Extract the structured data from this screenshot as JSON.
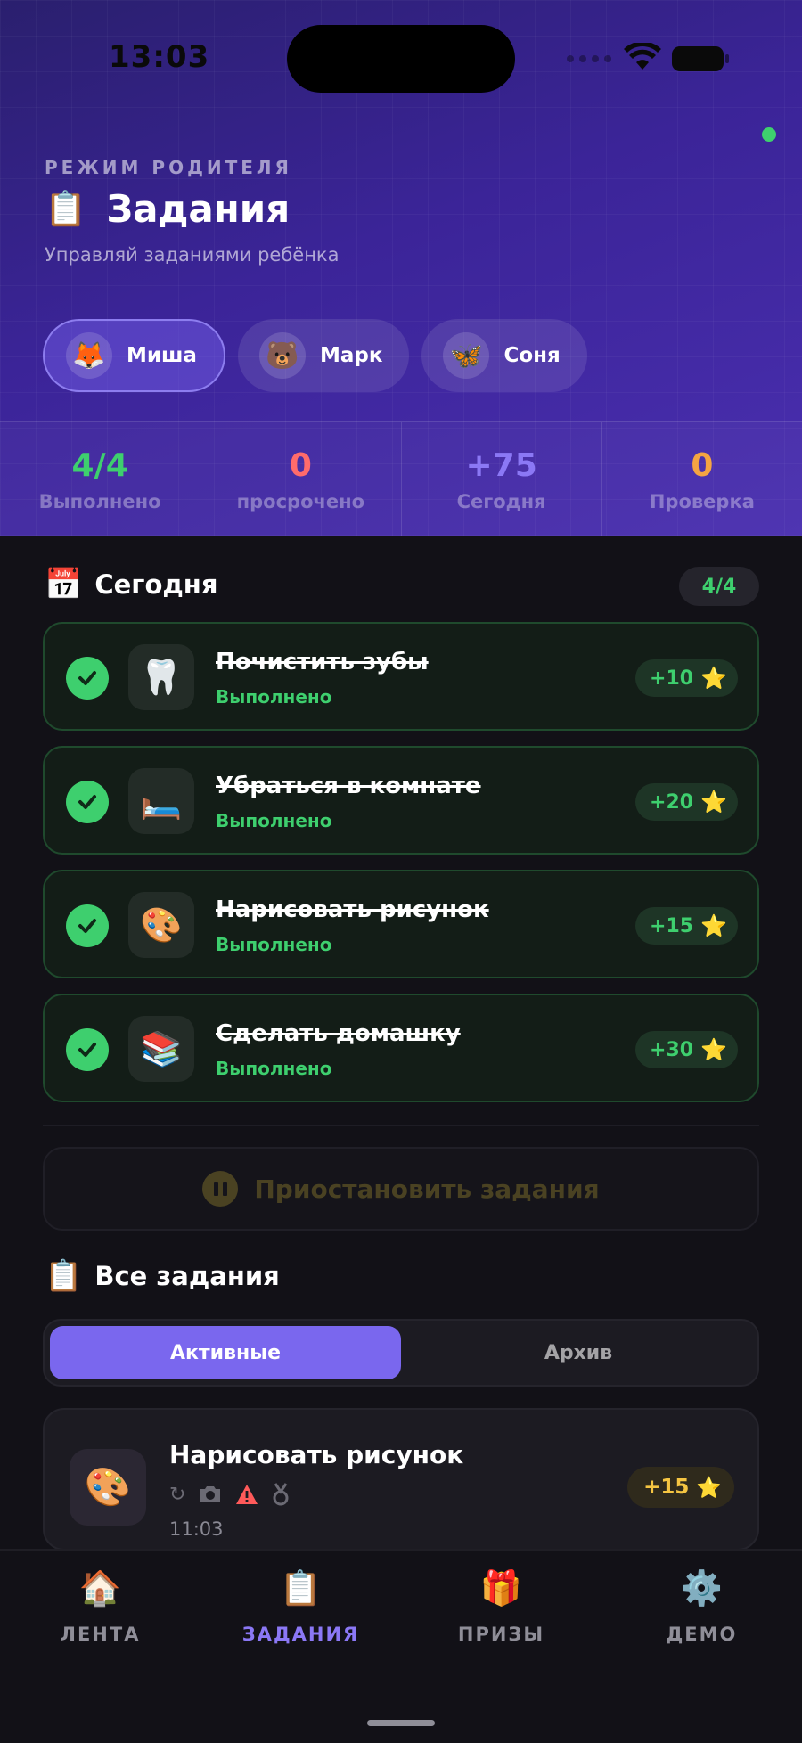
{
  "status_bar": {
    "time": "13:03"
  },
  "header": {
    "mode_label": "РЕЖИМ РОДИТЕЛЯ",
    "title_icon": "📋",
    "title": "Задания",
    "subtitle": "Управляй заданиями ребёнка"
  },
  "kids": [
    {
      "avatar": "🦊",
      "name": "Миша",
      "active": true
    },
    {
      "avatar": "🐻",
      "name": "Марк",
      "active": false
    },
    {
      "avatar": "🦋",
      "name": "Соня",
      "active": false
    }
  ],
  "stats": [
    {
      "value": "4/4",
      "label": "Выполнено",
      "color": "#3ecf6e"
    },
    {
      "value": "0",
      "label": "просрочено",
      "color": "#ff6b6b"
    },
    {
      "value": "+75",
      "label": "Сегодня",
      "color": "#8b78f5"
    },
    {
      "value": "0",
      "label": "Проверка",
      "color": "#f5a442"
    }
  ],
  "today": {
    "icon": "📅",
    "title": "Сегодня",
    "badge": "4/4",
    "tasks": [
      {
        "icon": "🦷",
        "name": "Почистить зубы",
        "status": "Выполнено",
        "reward": "+10",
        "star": "⭐"
      },
      {
        "icon": "🛏️",
        "name": "Убраться в комнате",
        "status": "Выполнено",
        "reward": "+20",
        "star": "⭐"
      },
      {
        "icon": "🎨",
        "name": "Нарисовать рисунок",
        "status": "Выполнено",
        "reward": "+15",
        "star": "⭐"
      },
      {
        "icon": "📚",
        "name": "Сделать домашку",
        "status": "Выполнено",
        "reward": "+30",
        "star": "⭐"
      }
    ]
  },
  "pause": {
    "label": "Приостановить задания"
  },
  "all_tasks": {
    "icon": "📋",
    "title": "Все задания",
    "tabs": {
      "active": "Активные",
      "archive": "Архив"
    },
    "cards": [
      {
        "icon": "🎨",
        "name": "Нарисовать рисунок",
        "meta_icons": [
          "repeat-icon",
          "camera-icon",
          "warning-icon",
          "medal-icon"
        ],
        "time": "11:03",
        "reward": "+15",
        "star": "⭐"
      }
    ]
  },
  "bottom_nav": [
    {
      "icon": "🏠",
      "label": "ЛЕНТА",
      "active": false
    },
    {
      "icon": "📋",
      "label": "ЗАДАНИЯ",
      "active": true
    },
    {
      "icon": "🎁",
      "label": "ПРИЗЫ",
      "active": false
    },
    {
      "icon": "⚙️",
      "label": "ДЕМО",
      "active": false
    }
  ],
  "colors": {
    "accent": "#7a67ee",
    "success": "#3ecf6e",
    "danger": "#ff6b6b",
    "warning": "#f5a442",
    "reward_gold": "#f5c542"
  }
}
